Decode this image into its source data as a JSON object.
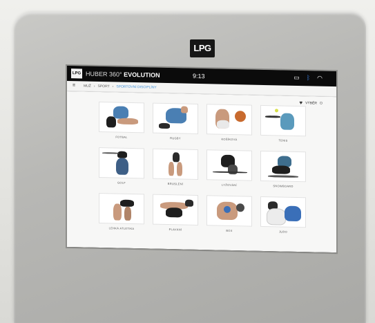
{
  "device": {
    "logo_text": "LPG"
  },
  "status_bar": {
    "app_logo_text": "LPG",
    "title_prefix": "HUBER 360°",
    "title_strong": "EVOLUTION",
    "time": "9:13"
  },
  "breadcrumb": {
    "items": [
      "MUŽ",
      "SPORT",
      "SPORTOVNÍ DISCIPLÍNY"
    ],
    "separator": "›"
  },
  "toolbar": {
    "button_label": "VÝBĚR"
  },
  "tiles": [
    {
      "label": "FOTBAL"
    },
    {
      "label": "RUGBY"
    },
    {
      "label": "KOŠÍKOVÁ"
    },
    {
      "label": "TENIS"
    },
    {
      "label": "GOLF"
    },
    {
      "label": "BRUSLENÍ"
    },
    {
      "label": "LYŽOVÁNÍ"
    },
    {
      "label": "SNOWBOARD"
    },
    {
      "label": "LEHKÁ ATLETIKA"
    },
    {
      "label": "PLAVÁNÍ"
    },
    {
      "label": "BOX"
    },
    {
      "label": "JUDO"
    }
  ],
  "colors": {
    "accent": "#3d8fd8",
    "jersey_blue": "#4a7fb3",
    "skin": "#c99a7d",
    "dark": "#1e1e1e"
  }
}
